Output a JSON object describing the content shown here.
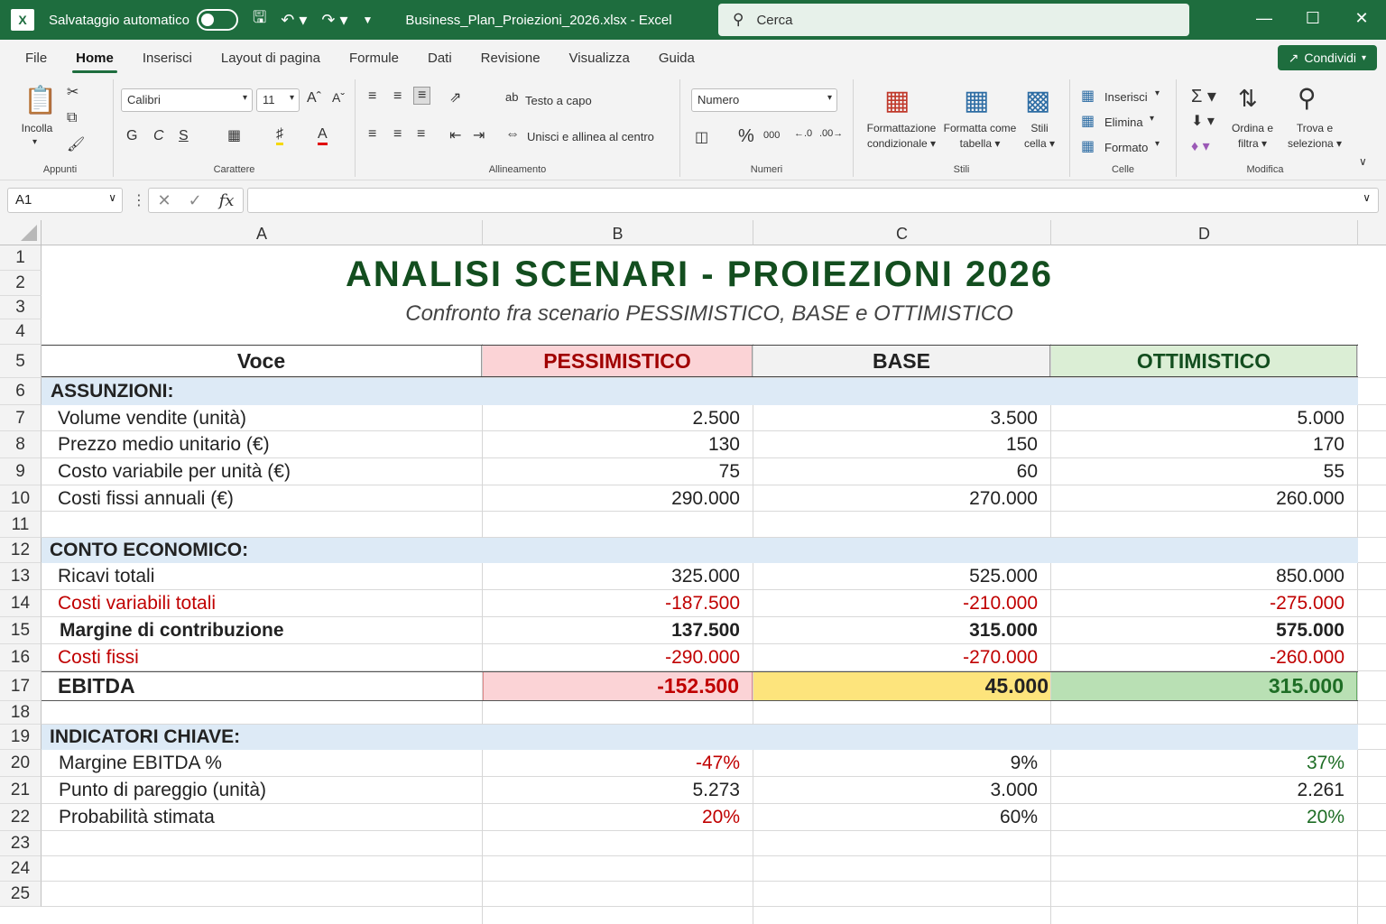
{
  "titlebar": {
    "logo": "X",
    "autosave_label": "Salvataggio automatico",
    "filename": "Business_Plan_Proiezioni_2026.xlsx",
    "separator": "-",
    "app": "Excel",
    "search_placeholder": "Cerca"
  },
  "menu": {
    "items": [
      "File",
      "Home",
      "Inserisci",
      "Layout di pagina",
      "Formule",
      "Dati",
      "Revisione",
      "Visualizza",
      "Guida"
    ],
    "active": "Home",
    "share_label": "Condividi"
  },
  "ribbon": {
    "paste_label": "Incolla",
    "clipboard_group": "Appunti",
    "font_name": "Calibri",
    "font_size": "11",
    "bold": "G",
    "italic": "C",
    "underline": "S",
    "font_group": "Carattere",
    "wrap_text": "Testo a capo",
    "merge_center": "Unisci e allinea al centro",
    "alignment_group": "Allineamento",
    "number_format": "Numero",
    "number_group": "Numeri",
    "cond_format_1": "Formattazione",
    "cond_format_2": "condizionale",
    "format_table_1": "Formatta come",
    "format_table_2": "tabella",
    "cell_styles_1": "Stili",
    "cell_styles_2": "cella",
    "styles_group": "Stili",
    "insert": "Inserisci",
    "delete": "Elimina",
    "format": "Formato",
    "cells_group": "Celle",
    "sort_1": "Ordina e",
    "sort_2": "filtra",
    "find_1": "Trova e",
    "find_2": "seleziona",
    "editing_group": "Modifica"
  },
  "formula_bar": {
    "name_box": "A1",
    "fx": "fx",
    "content": ""
  },
  "columns": [
    "A",
    "B",
    "C",
    "D"
  ],
  "rows": [
    "1",
    "2",
    "3",
    "4",
    "5",
    "6",
    "7",
    "8",
    "9",
    "10",
    "11",
    "12",
    "13",
    "14",
    "15",
    "16",
    "17",
    "18",
    "19",
    "20",
    "21",
    "22",
    "23",
    "24",
    "25"
  ],
  "sheet": {
    "title": "ANALISI SCENARI - PROIEZIONI 2026",
    "subtitle": "Confronto fra scenario PESSIMISTICO, BASE e OTTIMISTICO",
    "headers": [
      "Voce",
      "PESSIMISTICO",
      "BASE",
      "OTTIMISTICO"
    ],
    "section_assumptions": "ASSUNZIONI:",
    "assumptions": [
      {
        "label": "Volume vendite (unità)",
        "values": [
          "2.500",
          "3.500",
          "5.000"
        ]
      },
      {
        "label": "Prezzo medio unitario (€)",
        "values": [
          "130",
          "150",
          "170"
        ]
      },
      {
        "label": "Costo variabile per unità (€)",
        "values": [
          "75",
          "60",
          "55"
        ]
      },
      {
        "label": "Costi fissi annuali (€)",
        "values": [
          "290.000",
          "270.000",
          "260.000"
        ]
      }
    ],
    "section_income": "CONTO ECONOMICO:",
    "income": [
      {
        "label": "Ricavi totali",
        "values": [
          "325.000",
          "525.000",
          "850.000"
        ]
      },
      {
        "label": "Costi variabili totali",
        "values": [
          "-187.500",
          "-210.000",
          "-275.000"
        ]
      },
      {
        "label": "Margine di contribuzione",
        "values": [
          "137.500",
          "315.000",
          "575.000"
        ]
      },
      {
        "label": "Costi fissi",
        "values": [
          "-290.000",
          "-270.000",
          "-260.000"
        ]
      }
    ],
    "ebitda": {
      "label": "EBITDA",
      "values": [
        "-152.500",
        "45.000",
        "315.000"
      ]
    },
    "section_kpi": "INDICATORI CHIAVE:",
    "kpi": [
      {
        "label": "Margine EBITDA %",
        "values": [
          "-47%",
          "9%",
          "37%"
        ]
      },
      {
        "label": "Punto di pareggio (unità)",
        "values": [
          "5.273",
          "3.000",
          "2.261"
        ]
      },
      {
        "label": "Probabilità stimata",
        "values": [
          "20%",
          "60%",
          "20%"
        ]
      }
    ]
  },
  "colors": {
    "excel_green": "#1e6d3e",
    "pessimistic_fill": "#fbd3d6",
    "base_fill": "#fde47c",
    "optimistic_fill": "#b9e0b4",
    "section_fill": "#ddeaf6",
    "negative_text": "#c00000",
    "positive_text": "#1e6d25"
  }
}
